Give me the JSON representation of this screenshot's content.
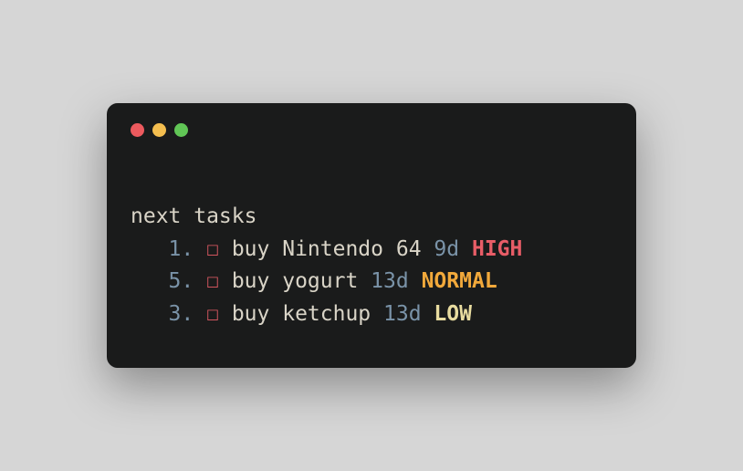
{
  "heading": "next tasks",
  "checkbox_glyph": "☐",
  "tasks": [
    {
      "index": "1.",
      "desc": "buy Nintendo 64",
      "age": "9d",
      "priority": "HIGH",
      "priority_class": "prio-high"
    },
    {
      "index": "5.",
      "desc": "buy yogurt",
      "age": "13d",
      "priority": "NORMAL",
      "priority_class": "prio-normal"
    },
    {
      "index": "3.",
      "desc": "buy ketchup",
      "age": "13d",
      "priority": "LOW",
      "priority_class": "prio-low"
    }
  ]
}
